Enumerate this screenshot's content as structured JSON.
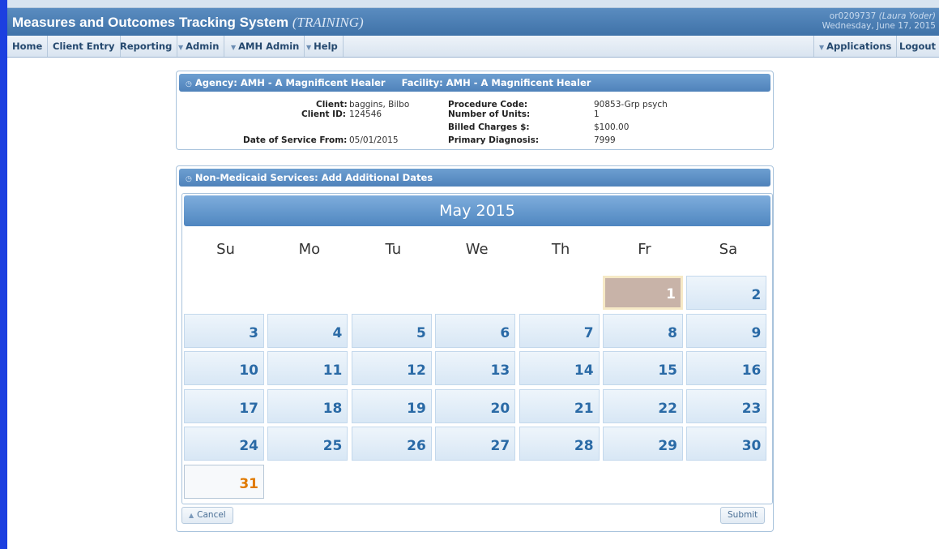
{
  "header": {
    "title": "Measures and Outcomes Tracking System",
    "title_suffix": "(TRAINING)",
    "user_id": "or0209737",
    "user_name": "(Laura Yoder)",
    "date": "Wednesday, June 17, 2015"
  },
  "nav": {
    "home": "Home",
    "client_entry": "Client Entry",
    "reporting": "Reporting",
    "admin": "Admin",
    "amh_admin": "AMH Admin",
    "help": "Help",
    "applications": "Applications",
    "logout": "Logout"
  },
  "agency_panel": {
    "agency_label": "Agency:",
    "agency": "AMH - A Magnificent Healer",
    "facility_label": "Facility:",
    "facility": "AMH - A Magnificent Healer",
    "client_label": "Client:",
    "client": "baggins, Bilbo",
    "client_id_label": "Client ID:",
    "client_id": "124546",
    "dos_label": "Date of Service From:",
    "dos": "05/01/2015",
    "procedure_label": "Procedure Code:",
    "procedure": "90853-Grp psych",
    "units_label": "Number of Units:",
    "units": "1",
    "charges_label": "Billed Charges $:",
    "charges": "$100.00",
    "diagnosis_label": "Primary Diagnosis:",
    "diagnosis": "7999"
  },
  "services_panel": {
    "title": "Non-Medicaid Services: Add Additional Dates"
  },
  "calendar": {
    "month_label": "May 2015",
    "weekdays": [
      "Su",
      "Mo",
      "Tu",
      "We",
      "Th",
      "Fr",
      "Sa"
    ],
    "first_weekday_index": 5,
    "days_in_month": 31,
    "selected_day": 1,
    "highlighted_day": 31
  },
  "buttons": {
    "cancel": "Cancel",
    "submit": "Submit"
  },
  "colors": {
    "accent": "#4f82ba",
    "selected_day": "#c8b3a8",
    "highlight_day_text": "#e07a00"
  }
}
